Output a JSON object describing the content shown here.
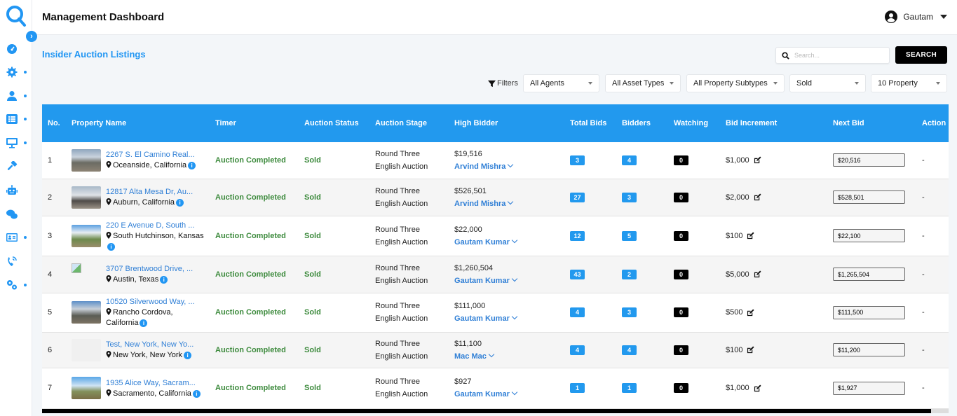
{
  "header": {
    "title": "Management Dashboard",
    "user_name": "Gautam"
  },
  "sidebar": {
    "items": [
      {
        "name": "dashboard",
        "icon": "speedometer-icon",
        "has_dot": false
      },
      {
        "name": "settings",
        "icon": "gear-icon",
        "has_dot": true
      },
      {
        "name": "users",
        "icon": "user-icon",
        "has_dot": true
      },
      {
        "name": "listings",
        "icon": "list-icon",
        "has_dot": true
      },
      {
        "name": "display",
        "icon": "monitor-icon",
        "has_dot": true
      },
      {
        "name": "auctions",
        "icon": "hammer-icon",
        "has_dot": false
      },
      {
        "name": "bots",
        "icon": "robot-icon",
        "has_dot": false
      },
      {
        "name": "messages",
        "icon": "chat-icon",
        "has_dot": false
      },
      {
        "name": "contacts",
        "icon": "id-card-icon",
        "has_dot": true
      },
      {
        "name": "calls",
        "icon": "phone-signal-icon",
        "has_dot": false
      },
      {
        "name": "advanced-settings",
        "icon": "gears-icon",
        "has_dot": true
      }
    ]
  },
  "page": {
    "section_title": "Insider Auction Listings"
  },
  "search": {
    "placeholder": "Search...",
    "button_label": "SEARCH"
  },
  "filters": {
    "label": "Filters",
    "agents": "All Agents",
    "asset_types": "All Asset Types",
    "property_subtypes": "All Property Subtypes",
    "status": "Sold",
    "page_size": "10 Property"
  },
  "table": {
    "columns": [
      "No.",
      "Property Name",
      "Timer",
      "Auction Status",
      "Auction Stage",
      "High Bidder",
      "Total Bids",
      "Bidders",
      "Watching",
      "Bid Increment",
      "Next Bid",
      "Action"
    ],
    "rows": [
      {
        "no": "1",
        "name": "2267 S. El Camino Real...",
        "location": "Oceanside, California",
        "timer": "Auction Completed",
        "status": "Sold",
        "round": "Round Three",
        "type": "English Auction",
        "high_bid": "$19,516",
        "bidder": "Arvind Mishra",
        "total_bids": "3",
        "bidders": "4",
        "watching": "0",
        "increment": "$1,000",
        "next_bid": "$20,516",
        "action": "-",
        "thumb": "photo"
      },
      {
        "no": "2",
        "name": "12817 Alta Mesa Dr, Au...",
        "location": "Auburn, California",
        "timer": "Auction Completed",
        "status": "Sold",
        "round": "Round Three",
        "type": "English Auction",
        "high_bid": "$526,501",
        "bidder": "Arvind Mishra",
        "total_bids": "27",
        "bidders": "3",
        "watching": "0",
        "increment": "$2,000",
        "next_bid": "$528,501",
        "action": "-",
        "thumb": "photo"
      },
      {
        "no": "3",
        "name": "220 E Avenue D, South ...",
        "location": "South Hutchinson, Kansas",
        "timer": "Auction Completed",
        "status": "Sold",
        "round": "Round Three",
        "type": "English Auction",
        "high_bid": "$22,000",
        "bidder": "Gautam Kumar",
        "total_bids": "12",
        "bidders": "5",
        "watching": "0",
        "increment": "$100",
        "next_bid": "$22,100",
        "action": "-",
        "thumb": "photo"
      },
      {
        "no": "4",
        "name": "3707 Brentwood Drive, ...",
        "location": "Austin, Texas",
        "timer": "Auction Completed",
        "status": "Sold",
        "round": "Round Three",
        "type": "English Auction",
        "high_bid": "$1,260,504",
        "bidder": "Gautam Kumar",
        "total_bids": "43",
        "bidders": "2",
        "watching": "0",
        "increment": "$5,000",
        "next_bid": "$1,265,504",
        "action": "-",
        "thumb": "broken"
      },
      {
        "no": "5",
        "name": "10520 Silverwood Way, ...",
        "location": "Rancho Cordova, California",
        "timer": "Auction Completed",
        "status": "Sold",
        "round": "Round Three",
        "type": "English Auction",
        "high_bid": "$111,000",
        "bidder": "Gautam Kumar",
        "total_bids": "4",
        "bidders": "3",
        "watching": "0",
        "increment": "$500",
        "next_bid": "$111,500",
        "action": "-",
        "thumb": "photo"
      },
      {
        "no": "6",
        "name": "Test, New York, New Yo...",
        "location": "New York, New York",
        "timer": "Auction Completed",
        "status": "Sold",
        "round": "Round Three",
        "type": "English Auction",
        "high_bid": "$11,100",
        "bidder": "Mac Mac",
        "total_bids": "4",
        "bidders": "4",
        "watching": "0",
        "increment": "$100",
        "next_bid": "$11,200",
        "action": "-",
        "thumb": "placeholder"
      },
      {
        "no": "7",
        "name": "1935 Alice Way, Sacram...",
        "location": "Sacramento, California",
        "timer": "Auction Completed",
        "status": "Sold",
        "round": "Round Three",
        "type": "English Auction",
        "high_bid": "$927",
        "bidder": "Gautam Kumar",
        "total_bids": "1",
        "bidders": "1",
        "watching": "0",
        "increment": "$1,000",
        "next_bid": "$1,927",
        "action": "-",
        "thumb": "photo"
      }
    ]
  },
  "colors": {
    "accent": "#2196f3",
    "header_row": "#2299ee",
    "success": "#3c8a3c",
    "dark_badge": "#000000"
  }
}
